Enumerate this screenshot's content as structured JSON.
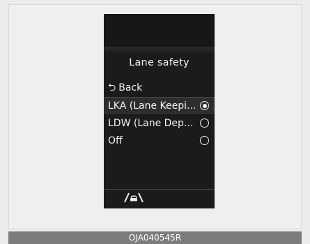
{
  "screen": {
    "title": "Lane safety",
    "menu": {
      "back_label": "Back",
      "back_icon": "back-arrow-icon",
      "items": [
        {
          "label": "LKA (Lane Keepi...",
          "selected": true
        },
        {
          "label": "LDW (Lane Dep...",
          "selected": false
        },
        {
          "label": "Off",
          "selected": false
        }
      ]
    },
    "footer_icon": "lane-assist-icon"
  },
  "caption": "OJA040545R"
}
